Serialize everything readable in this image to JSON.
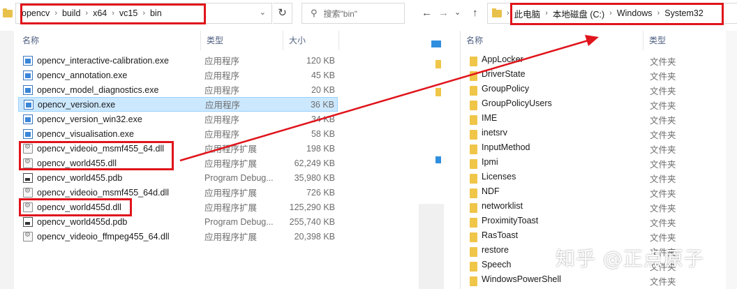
{
  "left": {
    "breadcrumb": [
      "opencv",
      "build",
      "x64",
      "vc15",
      "bin"
    ],
    "search_placeholder": "搜索\"bin\"",
    "columns": {
      "name": "名称",
      "type": "类型",
      "size": "大小"
    },
    "files": [
      {
        "name": "opencv_interactive-calibration.exe",
        "type": "应用程序",
        "size": "120 KB",
        "icon": "exe-icon"
      },
      {
        "name": "opencv_annotation.exe",
        "type": "应用程序",
        "size": "45 KB",
        "icon": "exe-icon"
      },
      {
        "name": "opencv_model_diagnostics.exe",
        "type": "应用程序",
        "size": "20 KB",
        "icon": "exe-icon"
      },
      {
        "name": "opencv_version.exe",
        "type": "应用程序",
        "size": "36 KB",
        "icon": "exe-icon",
        "selected": true
      },
      {
        "name": "opencv_version_win32.exe",
        "type": "应用程序",
        "size": "34 KB",
        "icon": "exe-icon"
      },
      {
        "name": "opencv_visualisation.exe",
        "type": "应用程序",
        "size": "58 KB",
        "icon": "exe-icon"
      },
      {
        "name": "opencv_videoio_msmf455_64.dll",
        "type": "应用程序扩展",
        "size": "198 KB",
        "icon": "dll-icon"
      },
      {
        "name": "opencv_world455.dll",
        "type": "应用程序扩展",
        "size": "62,249 KB",
        "icon": "dll-icon"
      },
      {
        "name": "opencv_world455.pdb",
        "type": "Program Debug...",
        "size": "35,980 KB",
        "icon": "pdb-icon"
      },
      {
        "name": "opencv_videoio_msmf455_64d.dll",
        "type": "应用程序扩展",
        "size": "726 KB",
        "icon": "dll-icon"
      },
      {
        "name": "opencv_world455d.dll",
        "type": "应用程序扩展",
        "size": "125,290 KB",
        "icon": "dll-icon"
      },
      {
        "name": "opencv_world455d.pdb",
        "type": "Program Debug...",
        "size": "255,740 KB",
        "icon": "pdb-icon"
      },
      {
        "name": "opencv_videoio_ffmpeg455_64.dll",
        "type": "应用程序扩展",
        "size": "20,398 KB",
        "icon": "dll-icon"
      }
    ]
  },
  "right": {
    "breadcrumb": [
      "此电脑",
      "本地磁盘 (C:)",
      "Windows",
      "System32"
    ],
    "columns": {
      "name": "名称",
      "type": "类型"
    },
    "folders": [
      {
        "name": "AppLocker",
        "type": "文件夹"
      },
      {
        "name": "DriverState",
        "type": "文件夹"
      },
      {
        "name": "GroupPolicy",
        "type": "文件夹"
      },
      {
        "name": "GroupPolicyUsers",
        "type": "文件夹"
      },
      {
        "name": "IME",
        "type": "文件夹"
      },
      {
        "name": "inetsrv",
        "type": "文件夹"
      },
      {
        "name": "InputMethod",
        "type": "文件夹"
      },
      {
        "name": "Ipmi",
        "type": "文件夹"
      },
      {
        "name": "Licenses",
        "type": "文件夹"
      },
      {
        "name": "NDF",
        "type": "文件夹"
      },
      {
        "name": "networklist",
        "type": "文件夹"
      },
      {
        "name": "ProximityToast",
        "type": "文件夹"
      },
      {
        "name": "RasToast",
        "type": "文件夹"
      },
      {
        "name": "restore",
        "type": "文件夹"
      },
      {
        "name": "Speech",
        "type": "文件夹"
      },
      {
        "name": "WindowsPowerShell",
        "type": "文件夹"
      }
    ]
  },
  "watermark": "知乎 @正点原子",
  "colors": {
    "highlight": "#e0141b",
    "selection": "#cce8ff",
    "folder": "#f0c649"
  }
}
